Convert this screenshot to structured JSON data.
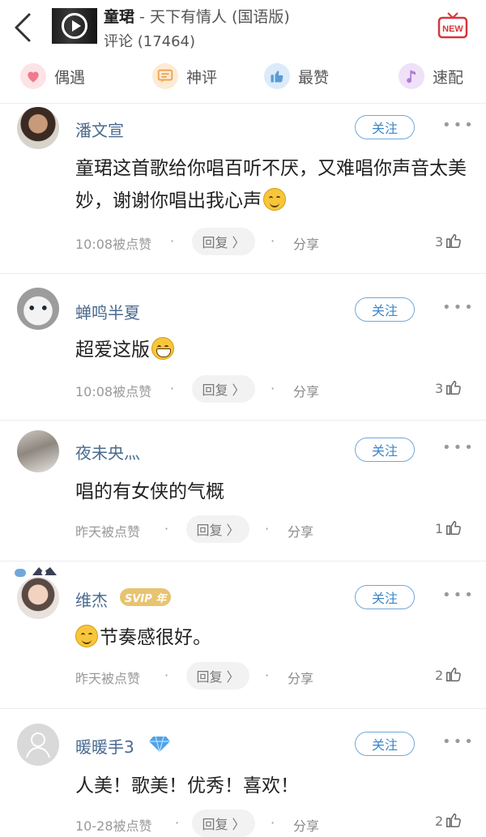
{
  "header": {
    "artist": "童珺",
    "song": " - 天下有情人 (国语版)",
    "comment_count_label": "评论 (17464)",
    "new_label": "NEW"
  },
  "tabs": [
    {
      "label": "偶遇",
      "icon": "heart-icon",
      "color": "#f28b9b"
    },
    {
      "label": "神评",
      "icon": "chat-bubble-icon",
      "color": "#f3a65a"
    },
    {
      "label": "最赞",
      "icon": "thumbs-up-icon",
      "color": "#6fa8dc"
    },
    {
      "label": "速配",
      "icon": "music-note-icon",
      "color": "#b07ad6"
    }
  ],
  "follow_label": "关注",
  "reply_label": "回复 〉",
  "share_label": "分享",
  "comments": [
    {
      "user": "潘文宣",
      "text": "童珺这首歌给你唱百听不厌，又难唱你声音太美妙，谢谢你唱出我心声",
      "meta": "10:08被点赞",
      "likes": "3"
    },
    {
      "user": "蝉鸣半夏",
      "text": "超爱这版",
      "meta": "10:08被点赞",
      "likes": "3"
    },
    {
      "user": "夜未央灬",
      "text": "唱的有女侠的气概",
      "meta": "昨天被点赞",
      "likes": "1"
    },
    {
      "user": "维杰",
      "badge": "SVIP 年",
      "text": "节奏感很好。",
      "meta": "昨天被点赞",
      "likes": "2"
    },
    {
      "user": "暖暖手3",
      "text": "人美！歌美！优秀！喜欢！",
      "meta": "10-28被点赞",
      "likes": "2"
    }
  ]
}
